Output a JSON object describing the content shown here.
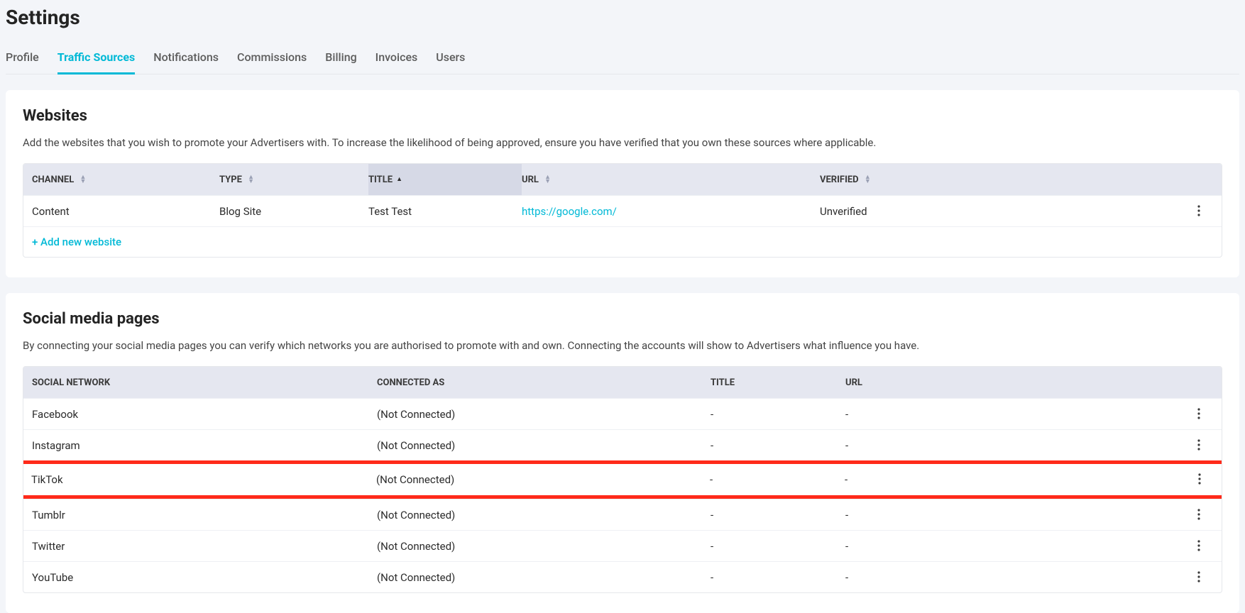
{
  "page": {
    "title": "Settings"
  },
  "tabs": [
    {
      "label": "Profile"
    },
    {
      "label": "Traffic Sources",
      "active": true
    },
    {
      "label": "Notifications"
    },
    {
      "label": "Commissions"
    },
    {
      "label": "Billing"
    },
    {
      "label": "Invoices"
    },
    {
      "label": "Users"
    }
  ],
  "websites": {
    "title": "Websites",
    "description": "Add the websites that you wish to promote your Advertisers with. To increase the likelihood of being approved, ensure you have verified that you own these sources where applicable.",
    "columns": {
      "channel": "CHANNEL",
      "type": "TYPE",
      "title": "TITLE",
      "url": "URL",
      "verified": "VERIFIED"
    },
    "rows": [
      {
        "channel": "Content",
        "type": "Blog Site",
        "title": "Test Test",
        "url": "https://google.com/",
        "verified": "Unverified"
      }
    ],
    "add_label": "+ Add new website"
  },
  "social": {
    "title": "Social media pages",
    "description": "By connecting your social media pages you can verify which networks you are authorised to promote with and own. Connecting the accounts will show to Advertisers what influence you have.",
    "columns": {
      "network": "SOCIAL NETWORK",
      "connected": "CONNECTED AS",
      "title": "TITLE",
      "url": "URL"
    },
    "rows": [
      {
        "network": "Facebook",
        "connected": "(Not Connected)",
        "title": "-",
        "url": "-"
      },
      {
        "network": "Instagram",
        "connected": "(Not Connected)",
        "title": "-",
        "url": "-"
      },
      {
        "network": "TikTok",
        "connected": "(Not Connected)",
        "title": "-",
        "url": "-",
        "highlight": true
      },
      {
        "network": "Tumblr",
        "connected": "(Not Connected)",
        "title": "-",
        "url": "-"
      },
      {
        "network": "Twitter",
        "connected": "(Not Connected)",
        "title": "-",
        "url": "-"
      },
      {
        "network": "YouTube",
        "connected": "(Not Connected)",
        "title": "-",
        "url": "-"
      }
    ]
  }
}
